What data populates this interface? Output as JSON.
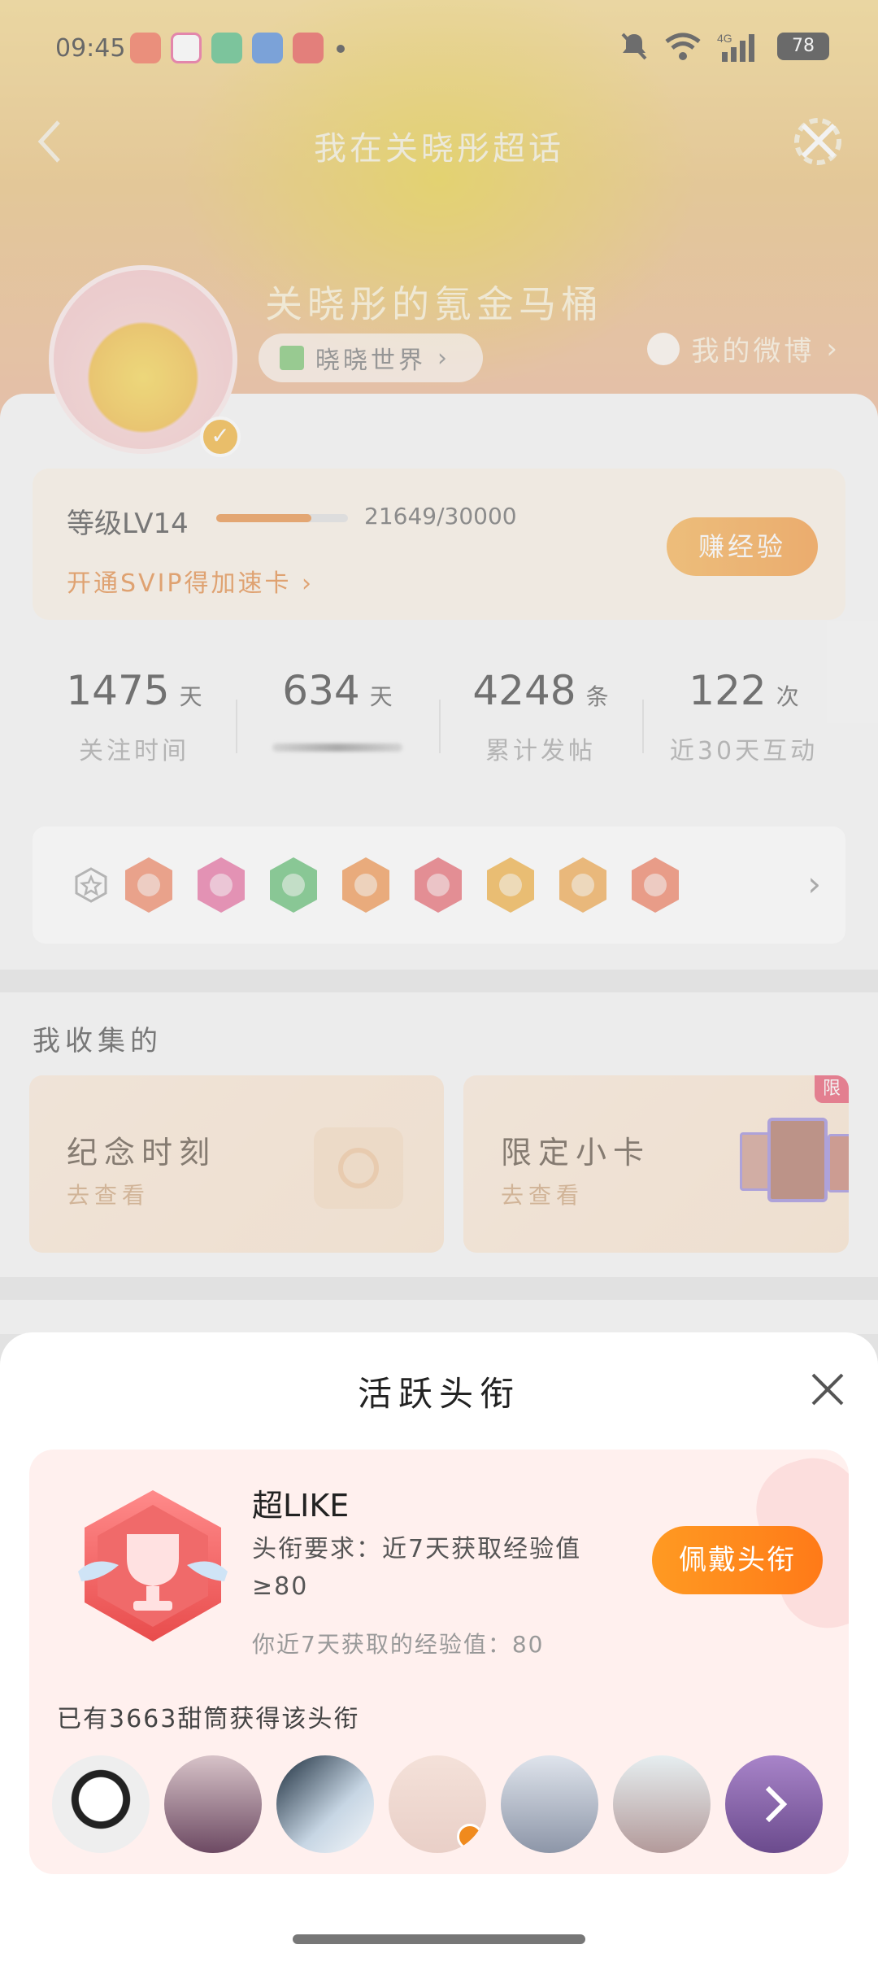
{
  "status_bar": {
    "time": "09:45",
    "battery": "78",
    "network": "4G"
  },
  "header": {
    "title": "我在关晓彤超话"
  },
  "profile": {
    "nickname": "关晓彤的氪金马桶",
    "world_tag": "晓晓世界",
    "my_weibo": "我的微博"
  },
  "level": {
    "label": "等级LV14",
    "progress": 0.7216,
    "value_text": "21649/30000",
    "svip_link": "开通SVIP得加速卡",
    "earn_button": "赚经验"
  },
  "stats": [
    {
      "num": "1475",
      "unit": "天",
      "label": "关注时间"
    },
    {
      "num": "634",
      "unit": "天",
      "label": ""
    },
    {
      "num": "4248",
      "unit": "条",
      "label": "累计发帖"
    },
    {
      "num": "122",
      "unit": "次",
      "label": "近30天互动"
    }
  ],
  "badges": {
    "items": [
      "cartoon-girl",
      "lv14",
      "hand-wave",
      "100-days",
      "trophy",
      "30-days",
      "emoji-face",
      "wing-hand"
    ],
    "colors": [
      "#f07a55",
      "#e8609a",
      "#52b865",
      "#f08a3c",
      "#e85a63",
      "#f0a82d",
      "#f0a03a",
      "#ef7050"
    ]
  },
  "collection": {
    "title": "我收集的",
    "cards": [
      {
        "title": "纪念时刻",
        "subtitle": "去查看"
      },
      {
        "title": "限定小卡",
        "subtitle": "去查看",
        "tag": "限"
      }
    ]
  },
  "modal": {
    "title": "活跃头衔",
    "badge_name": "超LIKE",
    "requirement": "头衔要求：近7天获取经验值≥80",
    "my_exp": "你近7天获取的经验值：80",
    "wear_button": "佩戴头衔",
    "holders_text": "已有3663甜筒获得该头衔",
    "holder_avatars": 7
  },
  "colors": {
    "accent": "#ff8a1e",
    "badge_red": "#ef5b5b"
  }
}
